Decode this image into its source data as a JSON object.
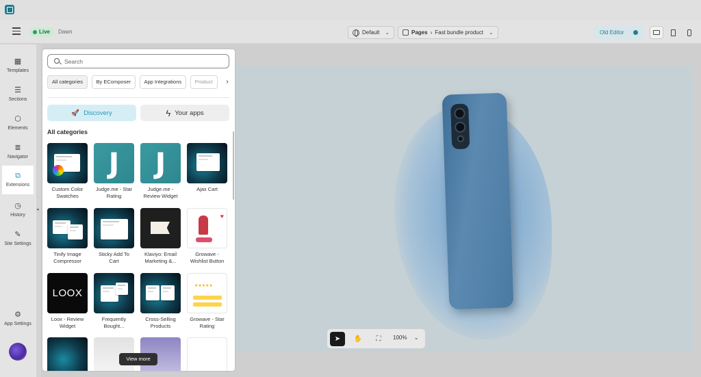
{
  "header": {
    "live_label": "Live",
    "theme_name": "Dawn",
    "language_select": "Default",
    "pages_label": "Pages",
    "page_name": "Fast bundle product",
    "old_editor_label": "Old Editor"
  },
  "sidebar": {
    "items": [
      {
        "label": "Templates",
        "icon": "templates-icon"
      },
      {
        "label": "Sections",
        "icon": "sections-icon"
      },
      {
        "label": "Elements",
        "icon": "elements-icon"
      },
      {
        "label": "Navigator",
        "icon": "navigator-icon"
      },
      {
        "label": "Extensions",
        "icon": "extensions-icon"
      },
      {
        "label": "History",
        "icon": "history-icon"
      },
      {
        "label": "Site Settings",
        "icon": "brush-icon"
      },
      {
        "label": "App Settings",
        "icon": "gear-icon"
      }
    ]
  },
  "extensions_panel": {
    "search_placeholder": "Search",
    "categories": [
      "All categories",
      "By EComposer",
      "App Integrations",
      "Product"
    ],
    "tabs": {
      "discovery": "Discovery",
      "your_apps": "Your apps"
    },
    "section_title": "All categories",
    "cards": [
      {
        "label": "Custom Color Swatches"
      },
      {
        "label": "Judge.me - Star Rating"
      },
      {
        "label": "Judge.me - Review Widget"
      },
      {
        "label": "Ajax Cart"
      },
      {
        "label": "Tinify Image Compressor"
      },
      {
        "label": "Sticky Add To Cart"
      },
      {
        "label": "Klaviyo: Email Marketing &..."
      },
      {
        "label": "Growave - Wishlist Button"
      },
      {
        "label": "Loox - Review Widget",
        "thumb_text": "LOOX"
      },
      {
        "label": "Frequently Bought..."
      },
      {
        "label": "Cross-Selling Products"
      },
      {
        "label": "Growave - Star Rating"
      }
    ],
    "judge_letter": "J",
    "view_more": "View more"
  },
  "canvas_toolbar": {
    "zoom": "100%"
  },
  "colors": {
    "accent": "#2b97b6",
    "live_green": "#2f9e55",
    "panel_bg": "#ffffff"
  }
}
